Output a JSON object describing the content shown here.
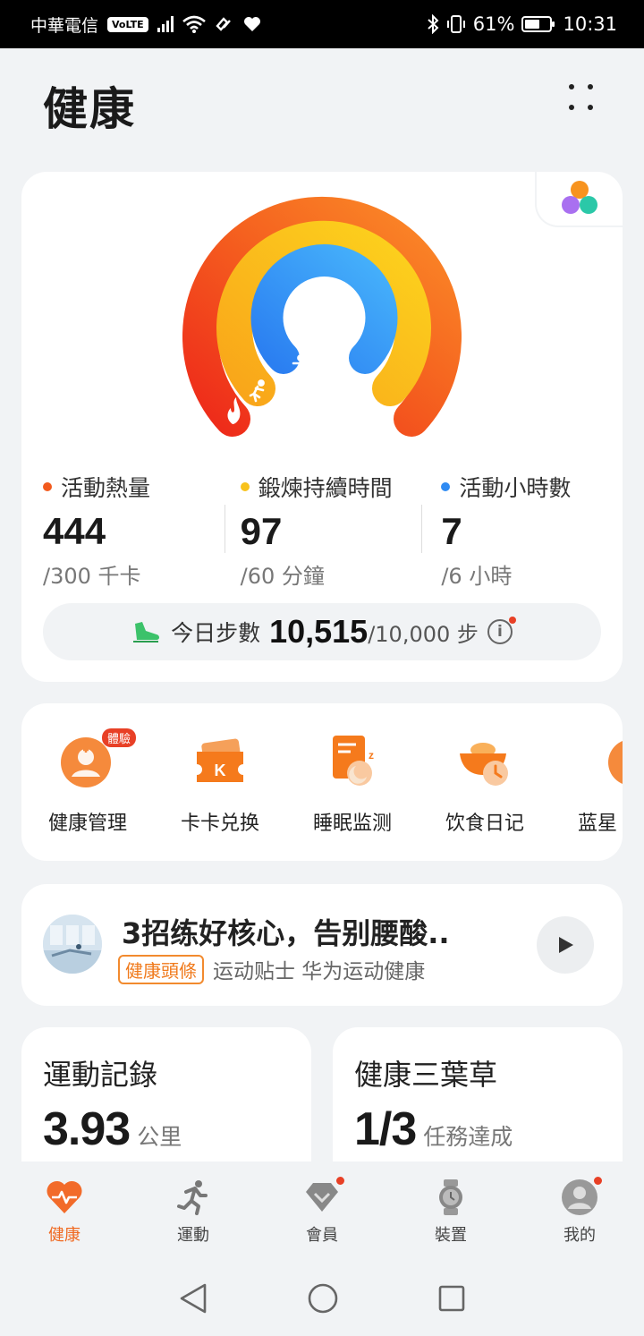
{
  "status_bar": {
    "carrier": "中華電信",
    "volte": "VoLTE",
    "battery": "61%",
    "battery_level": 0.61,
    "time": "10:31"
  },
  "header": {
    "title": "健康"
  },
  "activity": {
    "rings": [
      {
        "name": "calories",
        "color": "#f25a1d",
        "progress": 1.0
      },
      {
        "name": "exercise",
        "color": "#f8c21c",
        "progress": 1.0
      },
      {
        "name": "stand",
        "color": "#2f8bf3",
        "progress": 1.0
      }
    ],
    "stats": [
      {
        "label": "活動熱量",
        "value": "444",
        "goal": "/300 千卡",
        "color": "#f25a1d"
      },
      {
        "label": "鍛煉持續時間",
        "value": "97",
        "goal": "/60 分鐘",
        "color": "#f8c21c"
      },
      {
        "label": "活動小時數",
        "value": "7",
        "goal": "/6 小時",
        "color": "#2f8bf3"
      }
    ],
    "steps": {
      "label": "今日步數",
      "value": "10,515",
      "goal": "/10,000 步",
      "info": "i"
    }
  },
  "shortcuts": [
    {
      "label": "健康管理",
      "icon": "health-management-icon",
      "badge": "體驗"
    },
    {
      "label": "卡卡兑换",
      "icon": "kaka-exchange-icon"
    },
    {
      "label": "睡眠监测",
      "icon": "sleep-monitor-icon"
    },
    {
      "label": "饮食日记",
      "icon": "diet-diary-icon"
    },
    {
      "label": "蓝星",
      "icon": "blue-star-icon"
    }
  ],
  "article": {
    "title": "3招练好核心，告别腰酸..",
    "tag": "健康頭條",
    "meta": "运动贴士 华为运动健康"
  },
  "cards": [
    {
      "title": "運動記錄",
      "value": "3.93",
      "unit": "公里"
    },
    {
      "title": "健康三葉草",
      "value": "1/3",
      "unit": "任務達成"
    }
  ],
  "nav": [
    {
      "label": "健康",
      "icon": "heart-pulse-icon",
      "active": true
    },
    {
      "label": "運動",
      "icon": "running-icon",
      "active": false
    },
    {
      "label": "會員",
      "icon": "diamond-icon",
      "active": false,
      "dot": true
    },
    {
      "label": "裝置",
      "icon": "watch-icon",
      "active": false
    },
    {
      "label": "我的",
      "icon": "profile-icon",
      "active": false,
      "dot": true
    }
  ]
}
